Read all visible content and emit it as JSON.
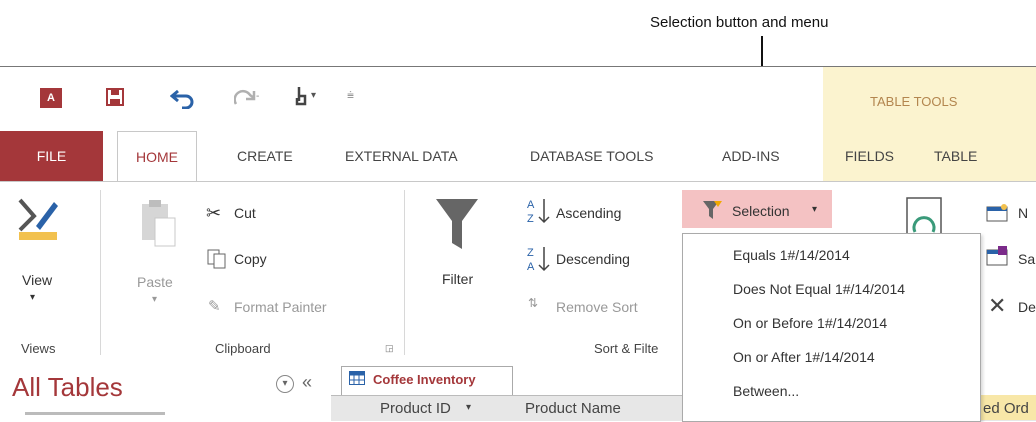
{
  "callout": "Selection button and menu",
  "title_bar": {
    "context_label": "TABLE TOOLS"
  },
  "tabs": [
    "FILE",
    "HOME",
    "CREATE",
    "EXTERNAL DATA",
    "DATABASE TOOLS",
    "ADD-INS",
    "FIELDS",
    "TABLE"
  ],
  "ribbon": {
    "views": {
      "view": "View",
      "group": "Views"
    },
    "clipboard": {
      "paste": "Paste",
      "cut": "Cut",
      "copy": "Copy",
      "format_painter": "Format Painter",
      "group": "Clipboard"
    },
    "sort_filter": {
      "filter": "Filter",
      "ascending": "Ascending",
      "descending": "Descending",
      "remove_sort": "Remove Sort",
      "selection": "Selection",
      "group": "Sort & Filte"
    },
    "records": {
      "new": "N",
      "save": "Sa",
      "delete": "De"
    }
  },
  "selection_menu": {
    "items": [
      "Equals 1#/14/2014",
      "Does Not Equal 1#/14/2014",
      "On or Before 1#/14/2014",
      "On or After 1#/14/2014",
      "Between..."
    ]
  },
  "nav_pane": {
    "title": "All Tables",
    "collapse": "«"
  },
  "document": {
    "tab": "Coffee Inventory",
    "columns": [
      "Product ID",
      "Product Name",
      "ed Ord"
    ]
  },
  "colors": {
    "file_tab": "#a4373a",
    "selection_highlight": "#f4c2c3",
    "table_tools": "#fbf3cf"
  }
}
